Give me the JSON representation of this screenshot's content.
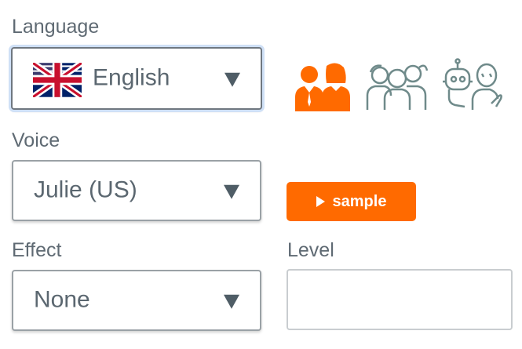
{
  "language": {
    "label": "Language",
    "selected": "English",
    "flag_icon": "uk-flag-icon"
  },
  "personas": [
    {
      "name": "adult-couple-icon",
      "selected": true,
      "color": "#ff6a00"
    },
    {
      "name": "children-icon",
      "selected": false,
      "color": "#6f8a8a"
    },
    {
      "name": "robot-icon",
      "selected": false,
      "color": "#6f8a8a"
    }
  ],
  "voice": {
    "label": "Voice",
    "selected": "Julie (US)"
  },
  "sample_button": {
    "label": "sample",
    "icon": "play-icon",
    "color": "#ff6a00"
  },
  "effect": {
    "label": "Effect",
    "selected": "None"
  },
  "level": {
    "label": "Level",
    "value": ""
  }
}
